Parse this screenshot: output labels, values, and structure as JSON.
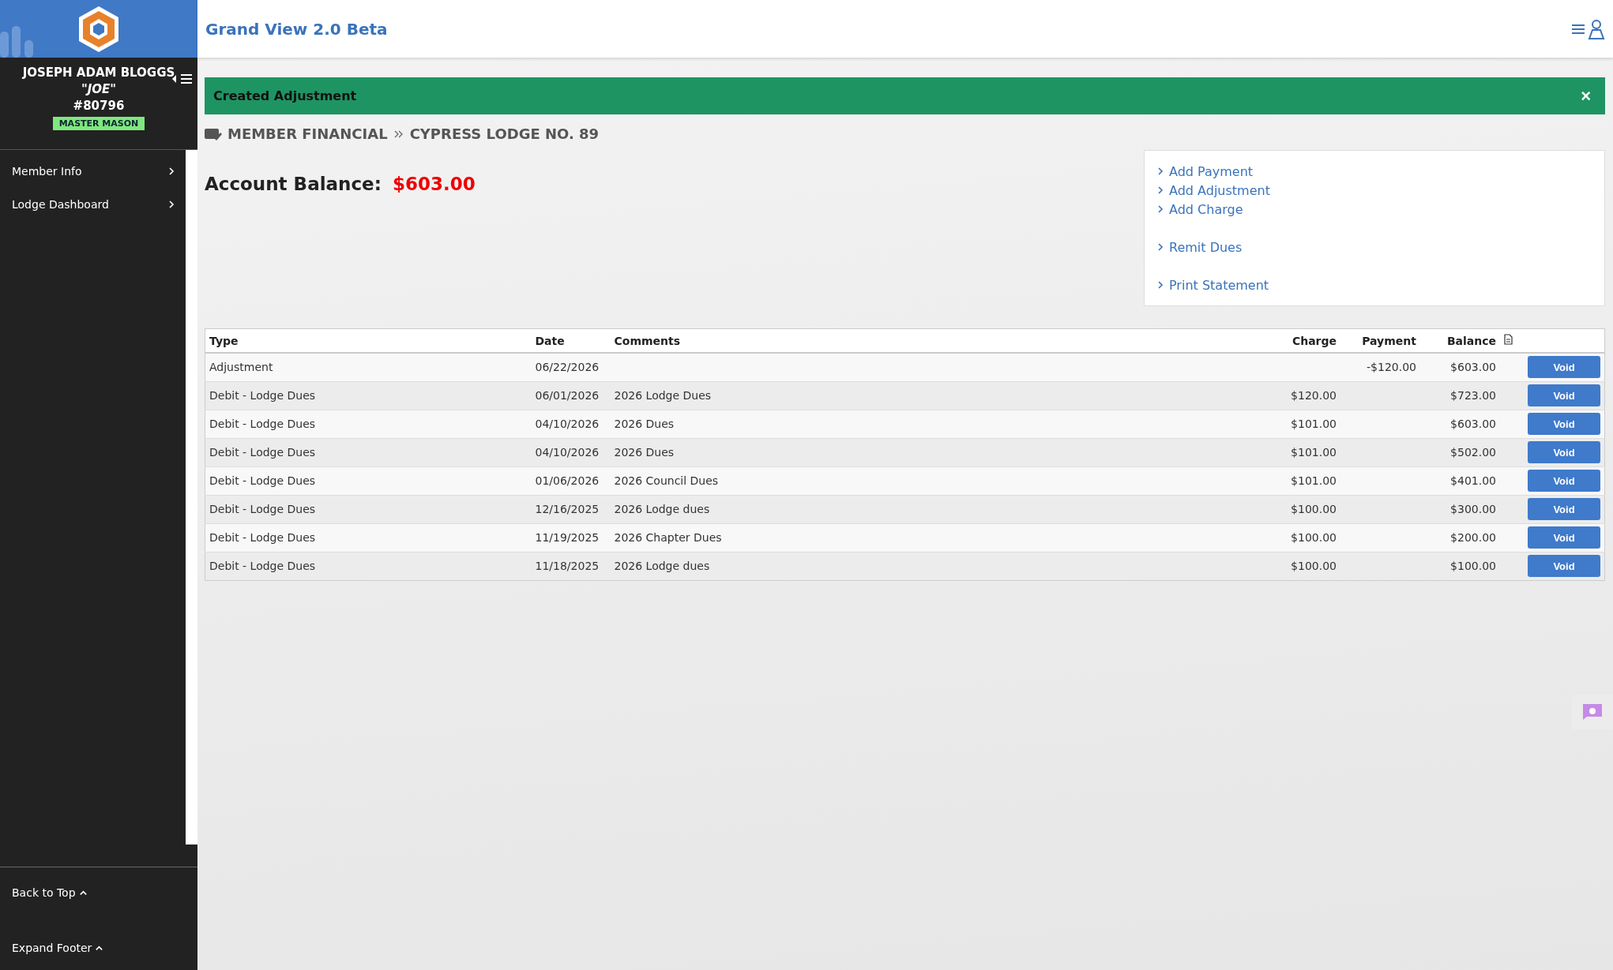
{
  "app": {
    "title": "Grand View 2.0 Beta"
  },
  "profile": {
    "name": "JOSEPH ADAM BLOGGS",
    "nickname": "\"JOE\"",
    "number": "#80796",
    "degree": "MASTER MASON"
  },
  "sidebar": {
    "items": [
      {
        "label": "Member Info"
      },
      {
        "label": "Lodge Dashboard"
      }
    ],
    "footer": [
      {
        "label": "Back to Top"
      },
      {
        "label": "Expand Footer"
      }
    ]
  },
  "alert": {
    "message": "Created Adjustment",
    "close": "×"
  },
  "breadcrumb": [
    "MEMBER FINANCIAL",
    "CYPRESS LODGE NO. 89"
  ],
  "balance": {
    "label": "Account Balance:",
    "amount": "$603.00"
  },
  "actions": [
    {
      "label": "Add Payment",
      "gap": false
    },
    {
      "label": "Add Adjustment",
      "gap": false
    },
    {
      "label": "Add Charge",
      "gap": false
    },
    {
      "label": "Remit Dues",
      "gap": true
    },
    {
      "label": "Print Statement",
      "gap": true
    }
  ],
  "table": {
    "columns": [
      "Type",
      "Date",
      "Comments",
      "Charge",
      "Payment",
      "Balance"
    ],
    "rows": [
      {
        "type": "Adjustment",
        "date": "06/22/2026",
        "comments": "",
        "charge": "",
        "payment": "-$120.00",
        "balance": "$603.00",
        "action": "Void"
      },
      {
        "type": "Debit - Lodge Dues",
        "date": "06/01/2026",
        "comments": "2026 Lodge Dues",
        "charge": "$120.00",
        "payment": "",
        "balance": "$723.00",
        "action": "Void"
      },
      {
        "type": "Debit - Lodge Dues",
        "date": "04/10/2026",
        "comments": "2026 Dues",
        "charge": "$101.00",
        "payment": "",
        "balance": "$603.00",
        "action": "Void"
      },
      {
        "type": "Debit - Lodge Dues",
        "date": "04/10/2026",
        "comments": "2026 Dues",
        "charge": "$101.00",
        "payment": "",
        "balance": "$502.00",
        "action": "Void"
      },
      {
        "type": "Debit - Lodge Dues",
        "date": "01/06/2026",
        "comments": "2026 Council Dues",
        "charge": "$101.00",
        "payment": "",
        "balance": "$401.00",
        "action": "Void"
      },
      {
        "type": "Debit - Lodge Dues",
        "date": "12/16/2025",
        "comments": "2026 Lodge dues",
        "charge": "$100.00",
        "payment": "",
        "balance": "$300.00",
        "action": "Void"
      },
      {
        "type": "Debit - Lodge Dues",
        "date": "11/19/2025",
        "comments": "2026 Chapter Dues",
        "charge": "$100.00",
        "payment": "",
        "balance": "$200.00",
        "action": "Void"
      },
      {
        "type": "Debit - Lodge Dues",
        "date": "11/18/2025",
        "comments": "2026 Lodge dues",
        "charge": "$100.00",
        "payment": "",
        "balance": "$100.00",
        "action": "Void"
      }
    ]
  }
}
